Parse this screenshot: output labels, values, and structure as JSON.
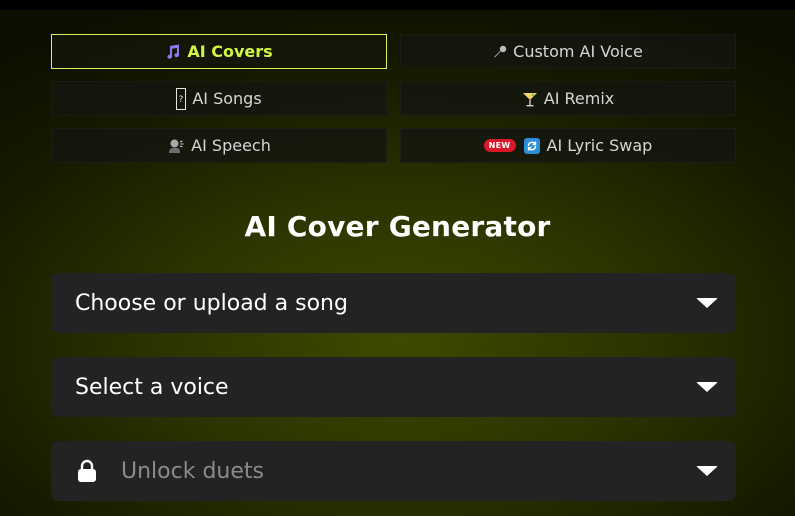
{
  "tabs": [
    {
      "label": "AI Covers",
      "icon": "music-note-icon",
      "glyph": "🎵",
      "active": true
    },
    {
      "label": "Custom AI Voice",
      "icon": "microphone-icon",
      "glyph": "🎤",
      "active": false
    },
    {
      "label": "AI Songs",
      "icon": "question-block-icon",
      "glyph": "❔",
      "active": false
    },
    {
      "label": "AI Remix",
      "icon": "cocktail-icon",
      "glyph": "🍸",
      "active": false
    },
    {
      "label": "AI Speech",
      "icon": "speaking-head-icon",
      "glyph": "🗣",
      "active": false
    },
    {
      "label": "AI Lyric Swap",
      "icon": "sync-icon",
      "glyph": "🔄",
      "badge": "NEW",
      "active": false
    }
  ],
  "heading": "AI Cover Generator",
  "selects": {
    "song": "Choose or upload a song",
    "voice": "Select a voice",
    "duets": "Unlock duets"
  },
  "colors": {
    "accent": "#d4f542",
    "badge": "#d9192a",
    "field_bg": "#232323"
  }
}
